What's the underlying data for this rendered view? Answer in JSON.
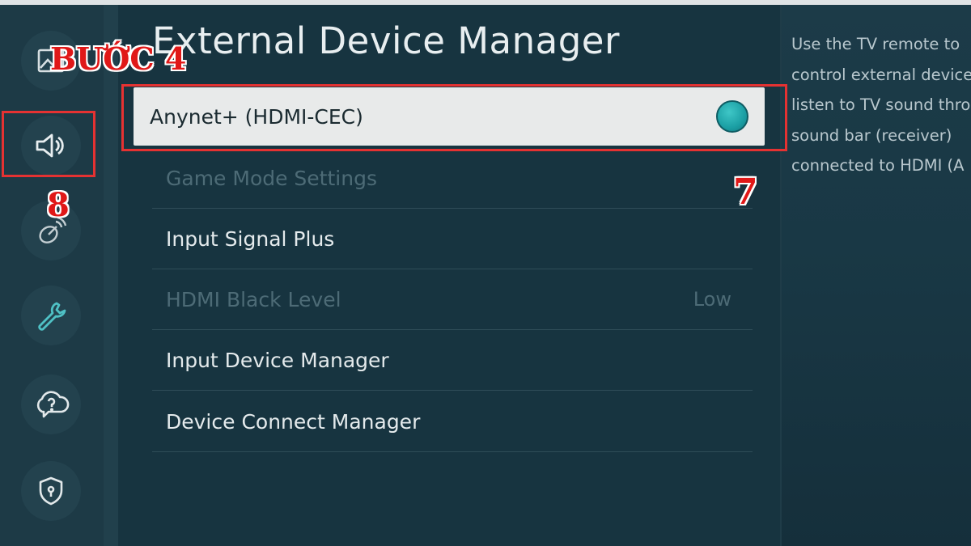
{
  "header": {
    "title": "External Device Manager"
  },
  "sidebar": {
    "icons": [
      {
        "name": "picture-icon"
      },
      {
        "name": "sound-icon"
      },
      {
        "name": "broadcasting-icon"
      },
      {
        "name": "wrench-icon"
      },
      {
        "name": "support-icon"
      },
      {
        "name": "privacy-shield-icon"
      }
    ]
  },
  "menu": {
    "selected": {
      "label": "Anynet+ (HDMI-CEC)",
      "toggle_on": true
    },
    "items": [
      {
        "label": "Game Mode Settings",
        "value": "",
        "enabled": false
      },
      {
        "label": "Input Signal Plus",
        "value": "",
        "enabled": true
      },
      {
        "label": "HDMI Black Level",
        "value": "Low",
        "enabled": false
      },
      {
        "label": "Input Device Manager",
        "value": "",
        "enabled": true
      },
      {
        "label": "Device Connect Manager",
        "value": "",
        "enabled": true
      }
    ]
  },
  "description": {
    "lines": [
      "Use the TV remote to",
      "control external device",
      "listen to TV sound thro",
      "sound bar (receiver)",
      "connected to HDMI (A"
    ]
  },
  "annotations": {
    "step4": "BƯỚC 4",
    "step7": "7",
    "step8": "8"
  },
  "colors": {
    "accent_toggle": "#1b9fa4",
    "annotation_red": "#e01818",
    "wrench_teal": "#4fc1c5"
  }
}
